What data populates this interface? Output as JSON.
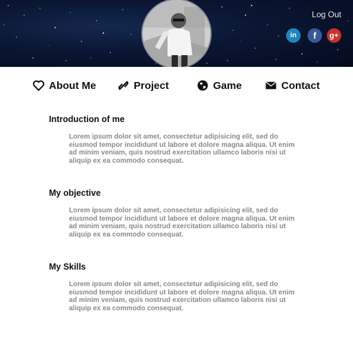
{
  "header": {
    "logout_label": "Log Out",
    "social": {
      "linkedin_label": "in",
      "facebook_label": "f",
      "googleplus_label": "g+"
    }
  },
  "nav": {
    "items": [
      {
        "label": "About Me",
        "icon": "heart-icon"
      },
      {
        "label": "Project",
        "icon": "link-icon"
      },
      {
        "label": "Game",
        "icon": "globe-icon"
      },
      {
        "label": "Contact",
        "icon": "envelope-icon"
      }
    ]
  },
  "sections": [
    {
      "title": "Introduction of me",
      "body": "Lorem ipsum dolor sit amet, consectetur adipisicing elit, sed do eiusmod tempor incididunt ut labore et dolore magna aliqua. Ut enim ad minim veniam, quis nostrud exercitation ullamco laboris nisi ut aliquip ex ea commodo consequat."
    },
    {
      "title": "My objective",
      "body": "Lorem ipsum dolor sit amet, consectetur adipisicing elit, sed do eiusmod tempor incididunt ut labore et dolore magna aliqua. Ut enim ad minim veniam, quis nostrud exercitation ullamco laboris nisi ut aliquip ex ea commodo consequat."
    },
    {
      "title": "My Skills",
      "body": "Lorem ipsum dolor sit amet, consectetur adipisicing elit, sed do eiusmod tempor incididunt ut labore et dolore magna aliqua. Ut enim ad minim veniam, quis nostrud exercitation ullamco laboris nisi ut aliquip ex ea commodo consequat."
    }
  ],
  "colors": {
    "banner_bg": "#0a1632",
    "linkedin": "#1d87bd",
    "facebook": "#3b5998",
    "googleplus": "#c8302a",
    "body_text": "#8a8a8a"
  }
}
